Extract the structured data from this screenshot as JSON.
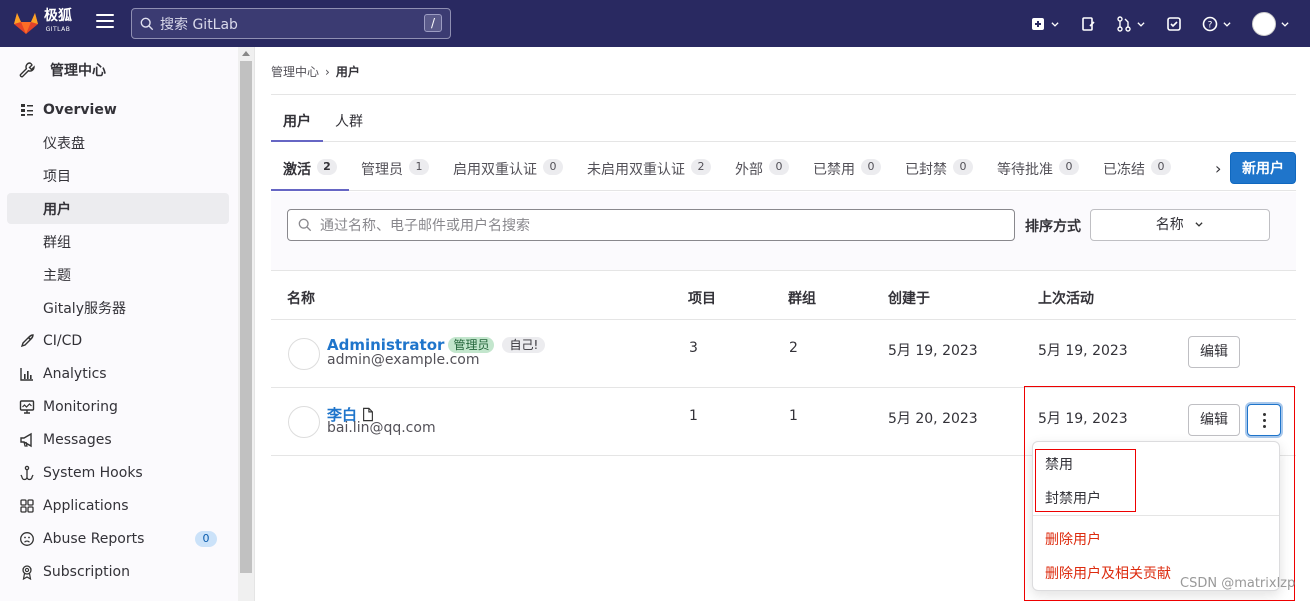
{
  "topbar": {
    "logo_text": "极狐",
    "logo_sub": "GITLAB",
    "search_placeholder": "搜索 GitLab",
    "search_shortcut": "/"
  },
  "sidebar": {
    "header": "管理中心",
    "items": [
      {
        "label": "Overview",
        "icon": "overview-icon"
      },
      {
        "label": "仪表盘"
      },
      {
        "label": "项目"
      },
      {
        "label": "用户"
      },
      {
        "label": "群组"
      },
      {
        "label": "主题"
      },
      {
        "label": "Gitaly服务器"
      },
      {
        "label": "CI/CD",
        "icon": "rocket-icon"
      },
      {
        "label": "Analytics",
        "icon": "chart-icon"
      },
      {
        "label": "Monitoring",
        "icon": "monitor-icon"
      },
      {
        "label": "Messages",
        "icon": "bullhorn-icon"
      },
      {
        "label": "System Hooks",
        "icon": "hook-icon"
      },
      {
        "label": "Applications",
        "icon": "apps-icon"
      },
      {
        "label": "Abuse Reports",
        "icon": "smiley-icon",
        "count": "0"
      },
      {
        "label": "Subscription",
        "icon": "badge-icon"
      }
    ]
  },
  "breadcrumb": {
    "parent": "管理中心",
    "sep": "›",
    "current": "用户"
  },
  "tabs_primary": [
    {
      "label": "用户"
    },
    {
      "label": "人群"
    }
  ],
  "tabs_filter": [
    {
      "label": "激活",
      "count": "2"
    },
    {
      "label": "管理员",
      "count": "1"
    },
    {
      "label": "启用双重认证",
      "count": "0"
    },
    {
      "label": "未启用双重认证",
      "count": "2"
    },
    {
      "label": "外部",
      "count": "0"
    },
    {
      "label": "已禁用",
      "count": "0"
    },
    {
      "label": "已封禁",
      "count": "0"
    },
    {
      "label": "等待批准",
      "count": "0"
    },
    {
      "label": "已冻结",
      "count": "0"
    }
  ],
  "tab_scroll_chevron": "›",
  "new_user_button": "新用户",
  "filter": {
    "placeholder": "通过名称、电子邮件或用户名搜索",
    "sort_label": "排序方式",
    "sort_value": "名称"
  },
  "table": {
    "headers": {
      "name": "名称",
      "projects": "项目",
      "groups": "群组",
      "created": "创建于",
      "last_activity": "上次活动"
    },
    "rows": [
      {
        "name": "Administrator",
        "badge_admin": "管理员",
        "badge_self": "自己!",
        "email": "admin@example.com",
        "projects": "3",
        "groups": "2",
        "created": "5月 19, 2023",
        "last_activity": "5月 19, 2023",
        "edit": "编辑"
      },
      {
        "name": "李白",
        "email": "bai.lin@qq.com",
        "projects": "1",
        "groups": "1",
        "created": "5月 20, 2023",
        "last_activity": "5月 19, 2023",
        "edit": "编辑"
      }
    ]
  },
  "dropdown": {
    "items": [
      "禁用",
      "封禁用户"
    ],
    "danger_items": [
      "删除用户",
      "删除用户及相关贡献"
    ]
  },
  "watermark": "CSDN @matrixlzp",
  "colors": {
    "topbar": "#292961",
    "primary": "#1f75cb",
    "danger": "#dd2b0e",
    "highlight": "#e00000"
  }
}
